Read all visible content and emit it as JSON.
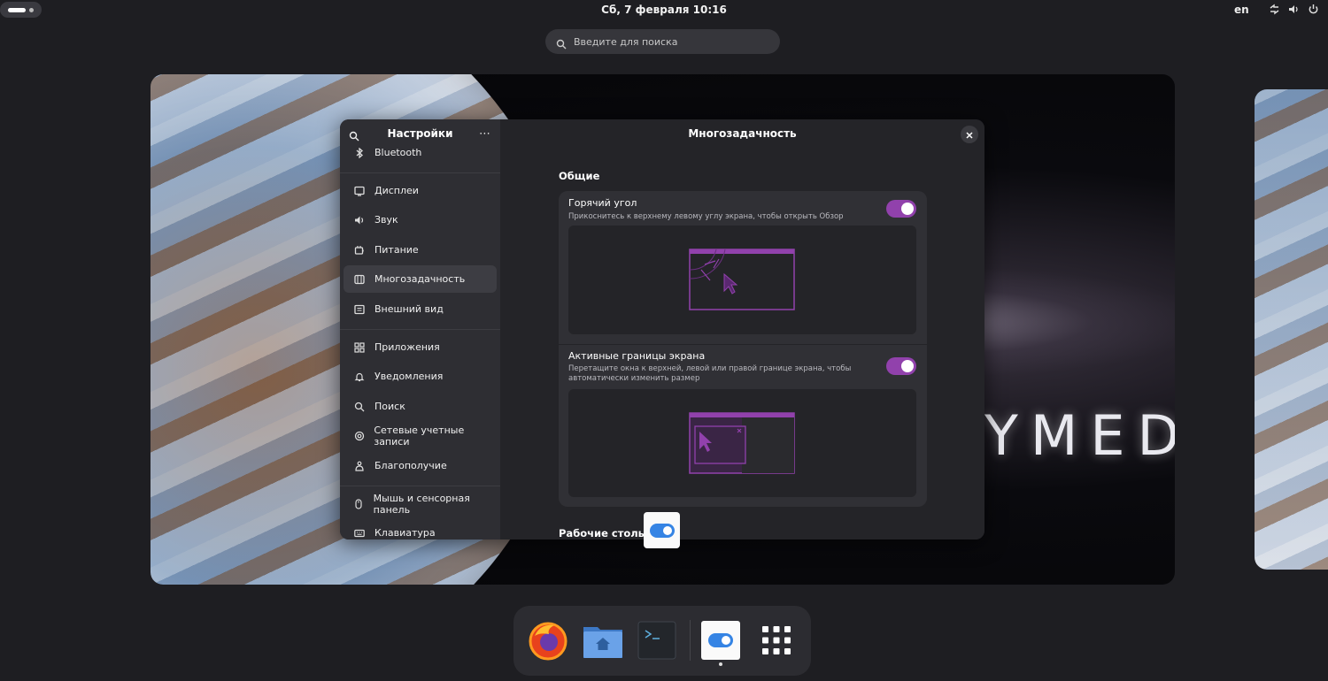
{
  "topbar": {
    "datetime": "Сб, 7 февраля  10:16",
    "lang": "en"
  },
  "search": {
    "placeholder": "Введите для поиска"
  },
  "wallpaper": {
    "text": "YMEDE"
  },
  "settings": {
    "sidebar_title": "Настройки",
    "menu_glyph": "⋯",
    "content_title": "Многозадачность",
    "items": [
      {
        "label": "Bluetooth",
        "icon": "bluetooth-icon"
      },
      {
        "label": "Дисплеи",
        "icon": "display-icon"
      },
      {
        "label": "Звук",
        "icon": "sound-icon"
      },
      {
        "label": "Питание",
        "icon": "power-icon"
      },
      {
        "label": "Многозадачность",
        "icon": "multitasking-icon",
        "active": true
      },
      {
        "label": "Внешний вид",
        "icon": "appearance-icon"
      },
      {
        "label": "Приложения",
        "icon": "apps-icon"
      },
      {
        "label": "Уведомления",
        "icon": "bell-icon"
      },
      {
        "label": "Поиск",
        "icon": "search-icon"
      },
      {
        "label": "Сетевые учетные записи",
        "icon": "online-accounts-icon"
      },
      {
        "label": "Благополучие",
        "icon": "wellbeing-icon"
      },
      {
        "label": "Мышь и сенсорная панель",
        "icon": "mouse-icon"
      },
      {
        "label": "Клавиатура",
        "icon": "keyboard-icon"
      }
    ],
    "section_general": "Общие",
    "hot_corner": {
      "title": "Горячий угол",
      "subtitle": "Прикоснитесь к верхнему левому углу экрана, чтобы открыть Обзор",
      "enabled": true
    },
    "edges": {
      "title": "Активные границы экрана",
      "subtitle": "Перетащите окна к верхней, левой или правой границе экрана, чтобы автоматически изменить размер",
      "enabled": true
    },
    "section_workspaces": "Рабочие столы"
  },
  "dock": {
    "apps": [
      "firefox-icon",
      "files-icon",
      "terminal-icon",
      "settings-icon",
      "app-grid-icon"
    ],
    "terminal_prompt": ">_"
  },
  "colors": {
    "accent": "#9141ac",
    "toggle_blue": "#3584e4"
  }
}
